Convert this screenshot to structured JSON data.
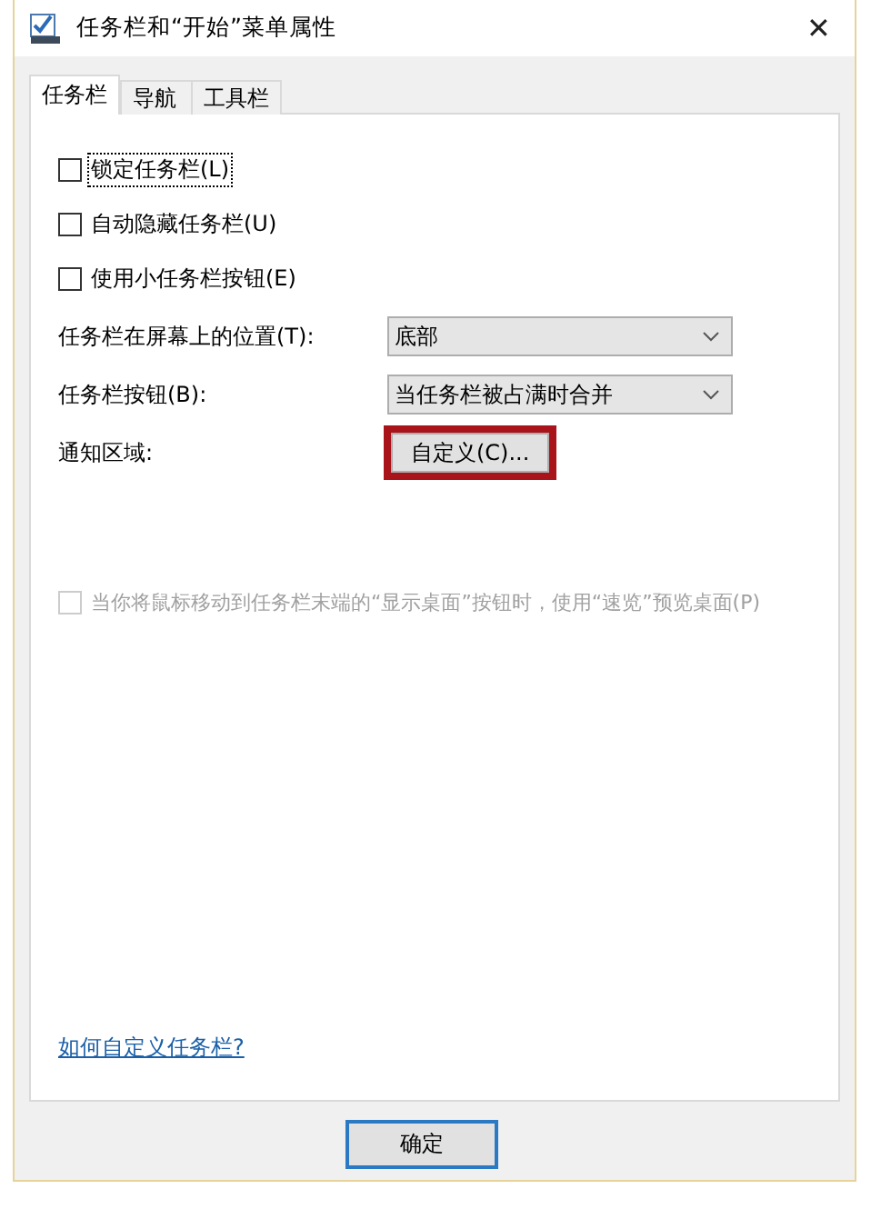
{
  "window": {
    "title": "任务栏和“开始”菜单属性",
    "close": "✕"
  },
  "tabs": [
    {
      "label": "任务栏",
      "selected": true
    },
    {
      "label": "导航",
      "selected": false
    },
    {
      "label": "工具栏",
      "selected": false
    }
  ],
  "options": [
    {
      "label": "锁定任务栏(L)",
      "checked": false,
      "focused": true
    },
    {
      "label": "自动隐藏任务栏(U)",
      "checked": false,
      "focused": false
    },
    {
      "label": "使用小任务栏按钮(E)",
      "checked": false,
      "focused": false
    }
  ],
  "settings": [
    {
      "kind": "dropdown",
      "label": "任务栏在屏幕上的位置(T):",
      "value": "底部"
    },
    {
      "kind": "dropdown",
      "label": "任务栏按钮(B):",
      "value": "当任务栏被占满时合并"
    },
    {
      "kind": "button",
      "label": "通知区域:",
      "value": "自定义(C)...",
      "highlighted": true
    }
  ],
  "peek_option": {
    "label": "当你将鼠标移动到任务栏末端的“显示桌面”按钮时，使用“速览”预览桌面(P)",
    "checked": false,
    "disabled": true
  },
  "help_link": "如何自定义任务栏?",
  "buttons": [
    {
      "label": "确定",
      "default": true
    }
  ]
}
